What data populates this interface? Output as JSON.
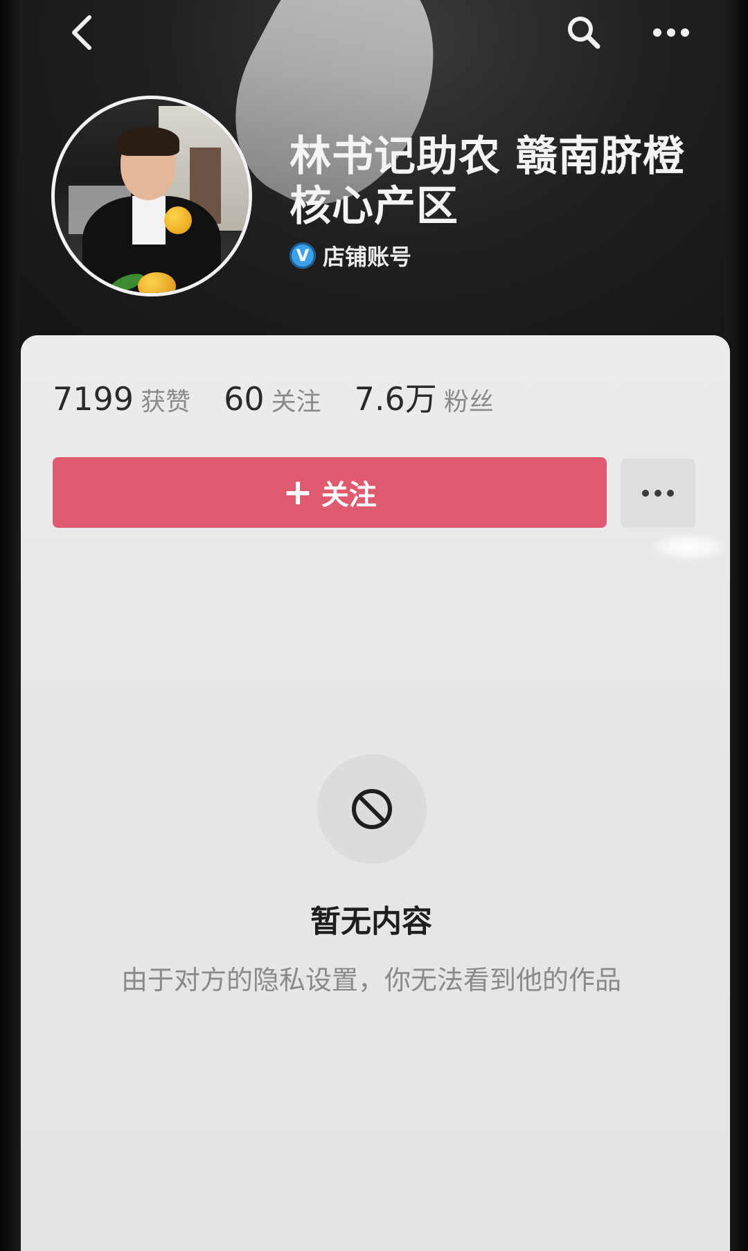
{
  "header": {
    "back_icon": "chevron-left-icon",
    "search_icon": "search-icon",
    "more_icon": "more-horizontal-icon"
  },
  "profile": {
    "name": "林书记助农 赣南脐橙核心产区",
    "badge_icon_text": "V",
    "badge_label": "店铺账号"
  },
  "stats": [
    {
      "value": "7199",
      "label": "获赞"
    },
    {
      "value": "60",
      "label": "关注"
    },
    {
      "value": "7.6万",
      "label": "粉丝"
    }
  ],
  "actions": {
    "follow_plus": "+",
    "follow_label": "关注",
    "more_label": "•••"
  },
  "empty_state": {
    "icon": "prohibited-icon",
    "title": "暂无内容",
    "description": "由于对方的隐私设置，你无法看到他的作品"
  },
  "colors": {
    "follow_button": "#df5a6f",
    "badge": "#3aa0e8",
    "card_bg": "#ececec"
  }
}
